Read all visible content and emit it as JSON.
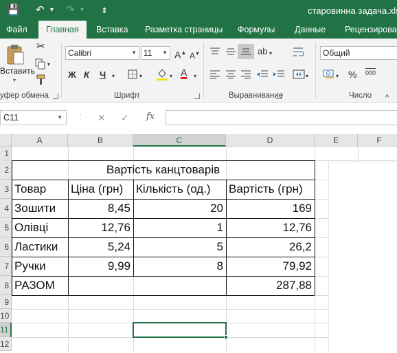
{
  "titlebar": {
    "title": "старовинна задача.xls",
    "save_icon": "💾",
    "undo_icon": "↶",
    "undo_dropdown": "▾",
    "redo_icon": "↷",
    "redo_dropdown": "▾",
    "qa_customize_icon": "⇟"
  },
  "tabs": [
    "Файл",
    "Главная",
    "Вставка",
    "Разметка страницы",
    "Формулы",
    "Данные",
    "Рецензирова"
  ],
  "ribbon": {
    "paste_label": "Вставить",
    "clipboard_label": "уфер обмена",
    "font_name": "Calibri",
    "font_size": "11",
    "font_label": "Шрифт",
    "bold": "Ж",
    "italic": "К",
    "underline": "Ч",
    "increase_font": "A",
    "decrease_font": "A",
    "font_color_letter": "A",
    "alignment_label": "Выравнивание",
    "number_format": "Общий",
    "number_label": "Число",
    "percent": "%",
    "comma_style": "000",
    "caret": "^",
    "accent_yellow": "#f5e200",
    "accent_red": "#e0201f"
  },
  "formula_bar": {
    "name_box": "C11",
    "formula": "",
    "cancel_icon": "✕",
    "enter_icon": "✓",
    "fx_label": "fx"
  },
  "grid": {
    "columns": [
      "A",
      "B",
      "C",
      "D",
      "E",
      "F"
    ],
    "rows": [
      "1",
      "2",
      "3",
      "4",
      "5",
      "6",
      "7",
      "8",
      "9",
      "10",
      "11",
      "12"
    ],
    "selected_cell": "C11"
  },
  "table": {
    "title": "Вартість канцтоварів",
    "headers": [
      "Товар",
      "Ціна (грн)",
      "Кількість (од.)",
      "Вартість (грн)"
    ],
    "rows": [
      [
        "Зошити",
        "8,45",
        "20",
        "169"
      ],
      [
        "Олівці",
        "12,76",
        "1",
        "12,76"
      ],
      [
        "Ластики",
        "5,24",
        "5",
        "26,2"
      ],
      [
        "Ручки",
        "9,99",
        "8",
        "79,92"
      ]
    ],
    "total_label": "РАЗОМ",
    "total_value": "287,88"
  },
  "colors": {
    "excel_green": "#217346",
    "ribbon_bg": "#f3f3f3",
    "header_bg": "#e6e6e6"
  }
}
